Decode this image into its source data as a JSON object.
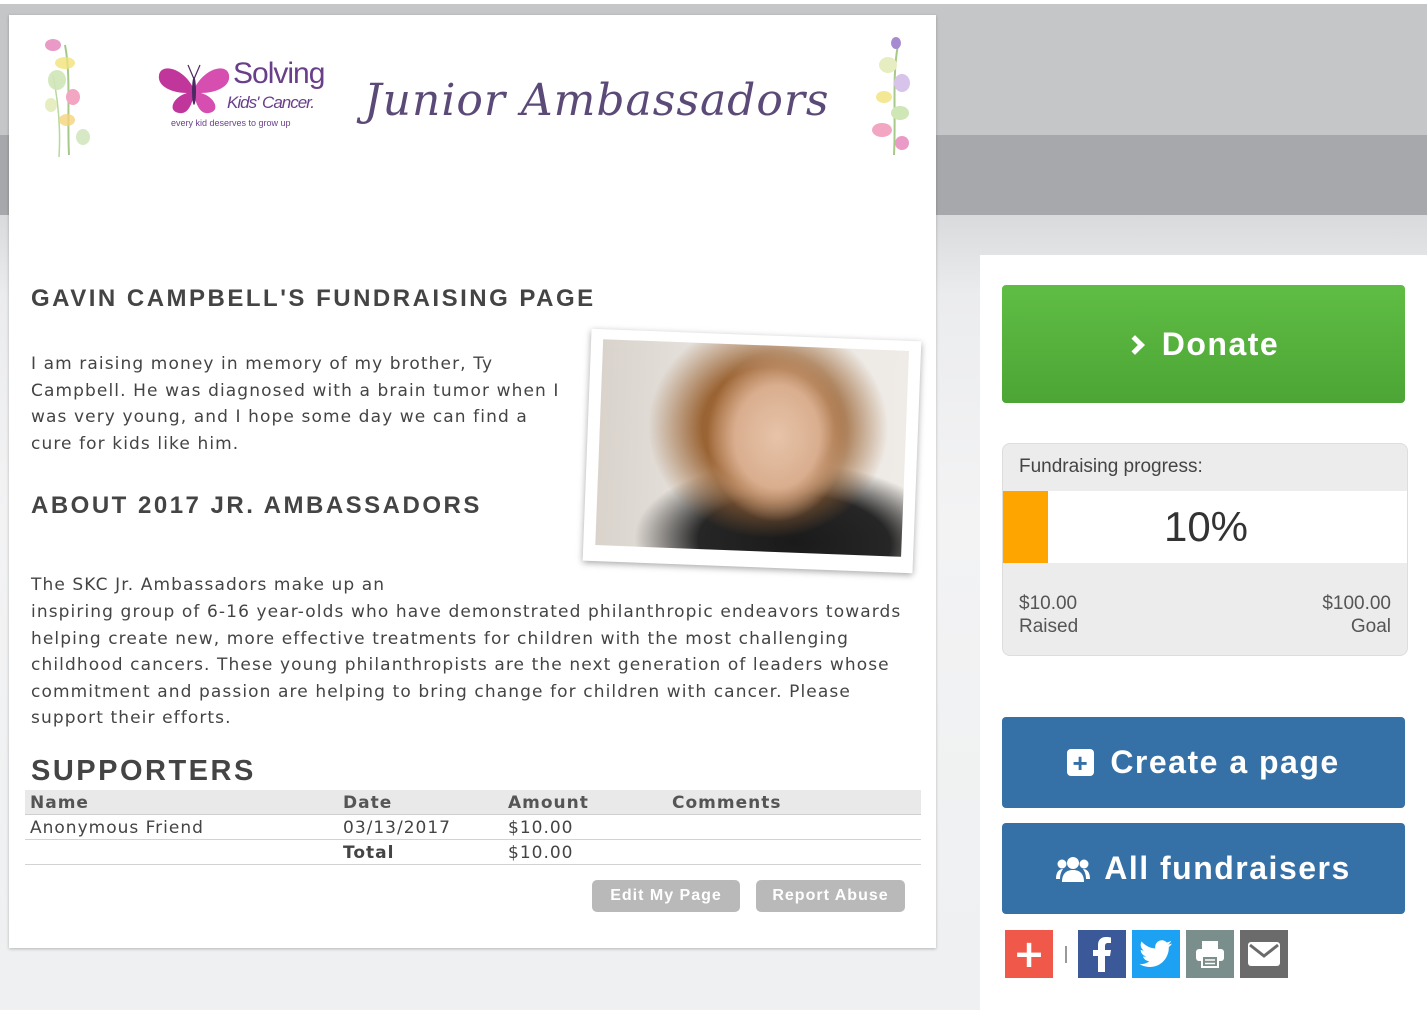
{
  "banner": {
    "logo_name": "Solving",
    "logo_sub": "Kids' Cancer.",
    "logo_tagline": "every kid deserves to grow up",
    "title": "Junior Ambassadors"
  },
  "page": {
    "heading": "GAVIN CAMPBELL'S FUNDRAISING PAGE",
    "intro": "I am raising money in memory of my brother, Ty Campbell.  He was diagnosed with a brain tumor when I was very young, and I hope some day we can find a cure for kids like him.",
    "about_heading": "ABOUT 2017 JR. AMBASSADORS",
    "about_line1": "The SKC Jr. Ambassadors make up an",
    "about_rest": "inspiring group of 6-16 year-olds who have demonstrated philanthropic endeavors towards helping create new, more effective treatments for children with the most challenging childhood cancers.  These young philanthropists are the next generation of leaders whose commitment and passion are helping to bring change for children with cancer.  Please support their efforts."
  },
  "supporters": {
    "heading": "SUPPORTERS",
    "columns": [
      "Name",
      "Date",
      "Amount",
      "Comments"
    ],
    "rows": [
      {
        "name": "Anonymous Friend",
        "date": "03/13/2017",
        "amount": "$10.00",
        "comments": ""
      }
    ],
    "total_label": "Total",
    "total_amount": "$10.00"
  },
  "actions": {
    "edit_label": "Edit My Page",
    "abuse_label": "Report Abuse"
  },
  "sidebar": {
    "donate_label": "Donate",
    "progress_label": "Fundraising progress:",
    "progress_percent": 10,
    "progress_text": "10%",
    "raised_amount": "$10.00",
    "raised_label": "Raised",
    "goal_amount": "$100.00",
    "goal_label": "Goal",
    "create_label": "Create a page",
    "all_label": "All fundraisers"
  },
  "share": {
    "icons": [
      "add-share-icon",
      "facebook-icon",
      "twitter-icon",
      "print-icon",
      "email-icon"
    ]
  },
  "colors": {
    "donate_green": "#55b23c",
    "button_blue": "#3571a7",
    "progress_orange": "#ffa500",
    "brand_purple": "#6a3f8a"
  }
}
